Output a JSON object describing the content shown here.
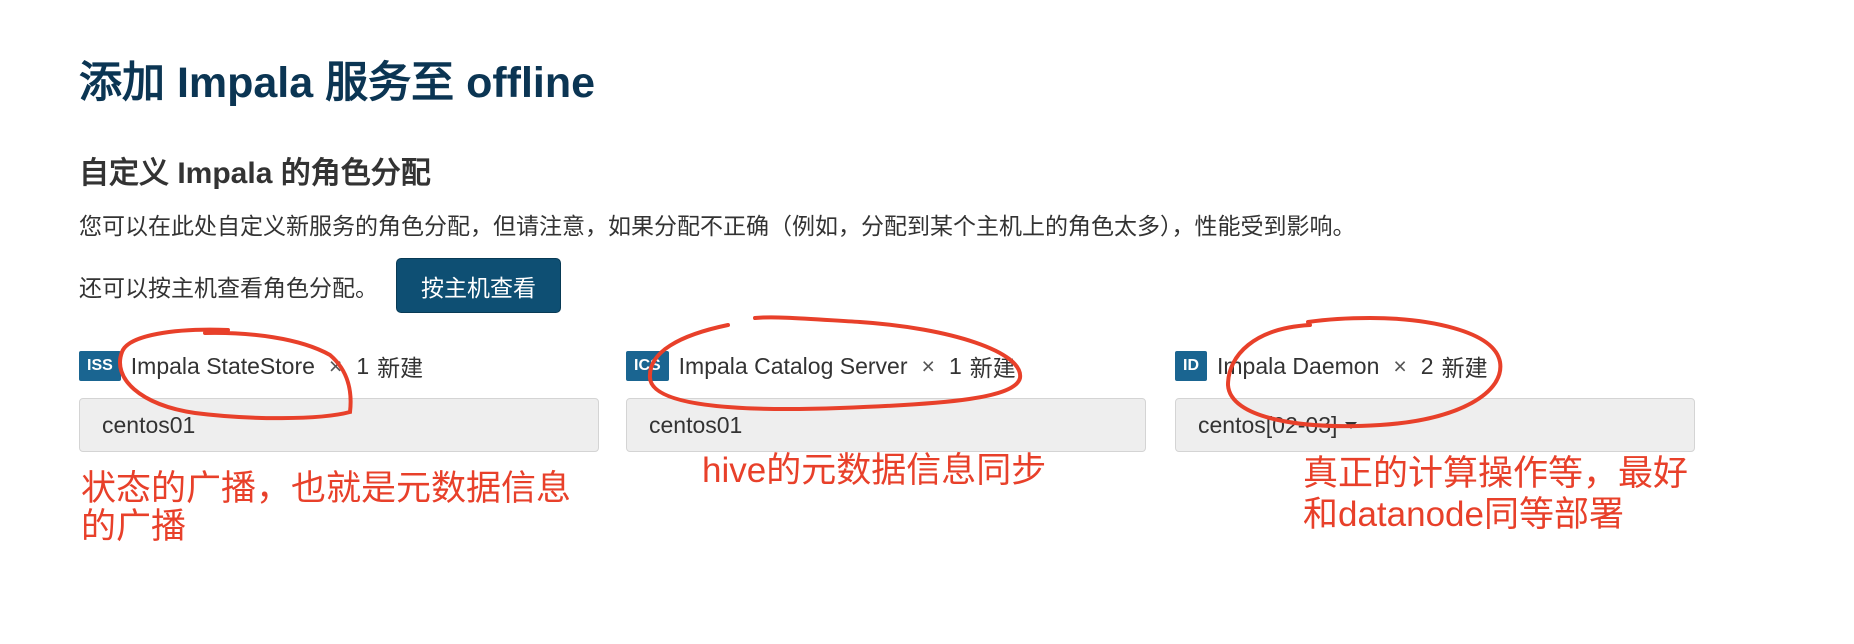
{
  "header": {
    "title": "添加 Impala 服务至 offline"
  },
  "section": {
    "title": "自定义 Impala 的角色分配",
    "description": "您可以在此处自定义新服务的角色分配，但请注意，如果分配不正确（例如，分配到某个主机上的角色太多），性能受到影响。",
    "view_by_host_prompt": "还可以按主机查看角色分配。",
    "view_by_host_button": "按主机查看"
  },
  "roles": [
    {
      "badge": "ISS",
      "name": "Impala StateStore",
      "times": "×",
      "count": "1",
      "new_label": "新建",
      "hosts": "centos01"
    },
    {
      "badge": "ICS",
      "name": "Impala Catalog Server",
      "times": "×",
      "count": "1",
      "new_label": "新建",
      "hosts": "centos01"
    },
    {
      "badge": "ID",
      "name": "Impala Daemon",
      "times": "×",
      "count": "2",
      "new_label": "新建",
      "hosts": "centos[02-03]"
    }
  ],
  "annotations": {
    "statestore_line1": "状态的广播，也就是元数据信息",
    "statestore_line2": "的广播",
    "catalog": "hive的元数据信息同步",
    "daemon_line1": "真正的计算操作等，最好",
    "daemon_line2": "和datanode同等部署"
  },
  "colors": {
    "title": "#0b3553",
    "button": "#0e4f73",
    "badge": "#1a6591",
    "annotation": "#e8402a"
  }
}
